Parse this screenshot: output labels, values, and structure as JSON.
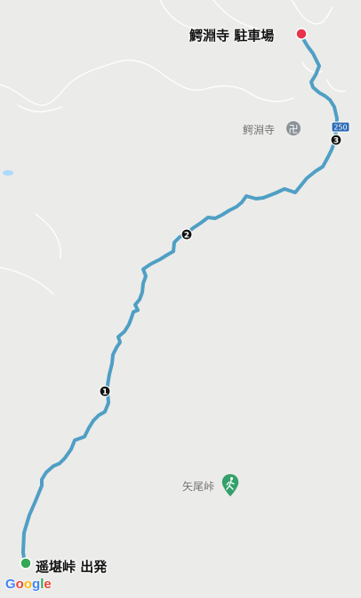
{
  "map": {
    "start": {
      "label": "遥堪峠 出発",
      "marker_color": "#34a853"
    },
    "end": {
      "label": "鰐淵寺 駐車場",
      "marker_color": "#e8334a"
    },
    "waypoints": [
      {
        "number": "1"
      },
      {
        "number": "2"
      },
      {
        "number": "3"
      }
    ],
    "pois": [
      {
        "name": "鰐淵寺",
        "icon": "temple-icon",
        "glyph": "卍"
      },
      {
        "name": "矢尾峠",
        "icon": "hiking-icon"
      }
    ],
    "road_shield": {
      "number": "250"
    },
    "route_color": "#4f9fc5",
    "water_color": "#aadaff"
  },
  "attribution": {
    "provider": "Google"
  }
}
